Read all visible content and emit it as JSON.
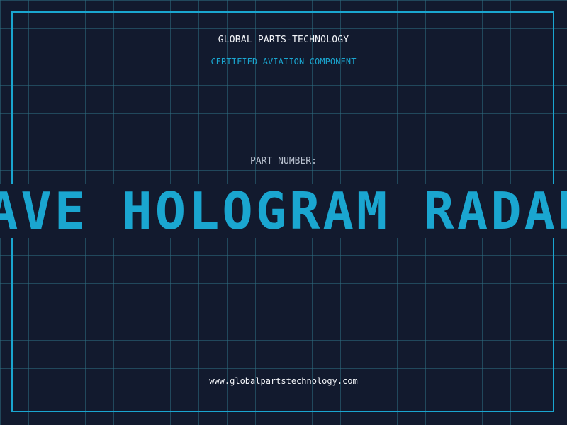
{
  "header": {
    "company": "GLOBAL PARTS-TECHNOLOGY",
    "tagline": "CERTIFIED AVIATION COMPONENT"
  },
  "part": {
    "label": "PART NUMBER:",
    "value": "AVE HOLOGRAM RADAR"
  },
  "footer": {
    "website": "www.globalpartstechnology.com"
  },
  "colors": {
    "background": "#121a2e",
    "accent": "#1aa6d0",
    "text": "#f2f4f8",
    "muted": "#b9c1cf"
  }
}
